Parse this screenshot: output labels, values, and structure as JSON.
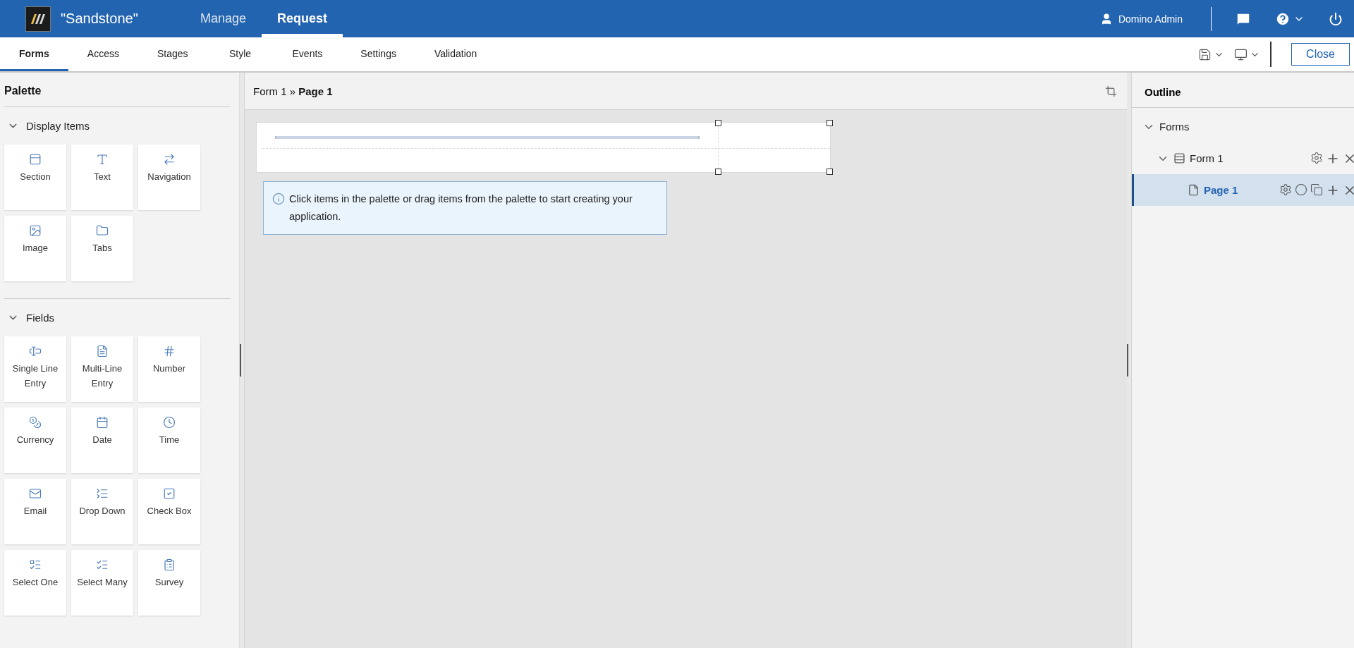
{
  "app": {
    "title": "\"Sandstone\"",
    "nav": [
      {
        "label": "Manage",
        "selected": false
      },
      {
        "label": "Request",
        "selected": true
      }
    ],
    "user": "Domino Admin"
  },
  "tabs": [
    {
      "label": "Forms",
      "selected": true
    },
    {
      "label": "Access",
      "selected": false
    },
    {
      "label": "Stages",
      "selected": false
    },
    {
      "label": "Style",
      "selected": false
    },
    {
      "label": "Events",
      "selected": false
    },
    {
      "label": "Settings",
      "selected": false
    },
    {
      "label": "Validation",
      "selected": false
    }
  ],
  "toolbar": {
    "close": "Close"
  },
  "palette": {
    "title": "Palette",
    "groups": [
      {
        "title": "Display Items",
        "expanded": true,
        "items": [
          {
            "label": "Section",
            "kind": "section"
          },
          {
            "label": "Text",
            "kind": "text"
          },
          {
            "label": "Navigation",
            "kind": "navigation"
          },
          {
            "label": "Image",
            "kind": "image"
          },
          {
            "label": "Tabs",
            "kind": "tabs"
          }
        ]
      },
      {
        "title": "Fields",
        "expanded": true,
        "items": [
          {
            "label": "Single Line Entry",
            "kind": "single"
          },
          {
            "label": "Multi-Line Entry",
            "kind": "multi"
          },
          {
            "label": "Number",
            "kind": "number"
          },
          {
            "label": "Currency",
            "kind": "currency"
          },
          {
            "label": "Date",
            "kind": "date"
          },
          {
            "label": "Time",
            "kind": "time"
          },
          {
            "label": "Email",
            "kind": "email"
          },
          {
            "label": "Drop Down",
            "kind": "dropdown"
          },
          {
            "label": "Check Box",
            "kind": "checkbox"
          },
          {
            "label": "Select One",
            "kind": "selectone"
          },
          {
            "label": "Select Many",
            "kind": "selectmany"
          },
          {
            "label": "Survey",
            "kind": "survey"
          }
        ]
      }
    ]
  },
  "canvas": {
    "breadcrumb": "Form 1 » **Page 1**",
    "hint": "Click items in the palette or drag items from the palette to start creating your application."
  },
  "outline": {
    "title": "Outline",
    "tree": [
      {
        "label": "Forms",
        "expanded": true,
        "selected": false,
        "children": [
          {
            "label": "Form 1",
            "kind": "form",
            "expanded": true,
            "selected": false,
            "children": [
              {
                "label": "Page 1",
                "kind": "page",
                "selected": true
              }
            ]
          }
        ]
      }
    ]
  }
}
